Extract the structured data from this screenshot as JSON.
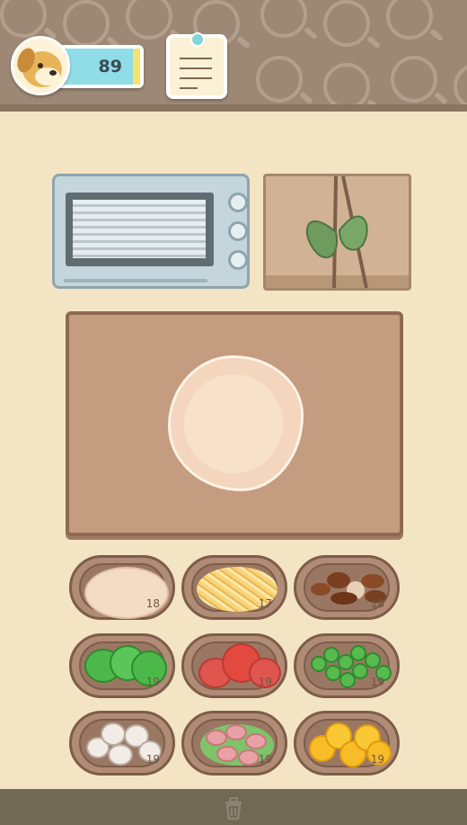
{
  "player": {
    "coins": "89",
    "avatar_icon": "dog-face-icon"
  },
  "notepad": {
    "icon": "order-notes-icon"
  },
  "appliances": {
    "oven": "oven-icon",
    "basket": "herb-basket-icon"
  },
  "board": {
    "item": "pizza-dough"
  },
  "ingredients": [
    {
      "name": "dough",
      "count": "18"
    },
    {
      "name": "cheese",
      "count": "17"
    },
    {
      "name": "mushroom-sauce",
      "count": "18"
    },
    {
      "name": "peppers",
      "count": "19"
    },
    {
      "name": "tomato",
      "count": "19"
    },
    {
      "name": "peas",
      "count": "19"
    },
    {
      "name": "mushrooms",
      "count": "19"
    },
    {
      "name": "ham",
      "count": "19"
    },
    {
      "name": "corn",
      "count": "19"
    }
  ],
  "footer": {
    "icon": "trash-icon"
  },
  "colors": {
    "counter": "#f3e5c3",
    "wall": "#9d8876",
    "board": "#c49c80",
    "coinbar": "#8fdde6"
  }
}
